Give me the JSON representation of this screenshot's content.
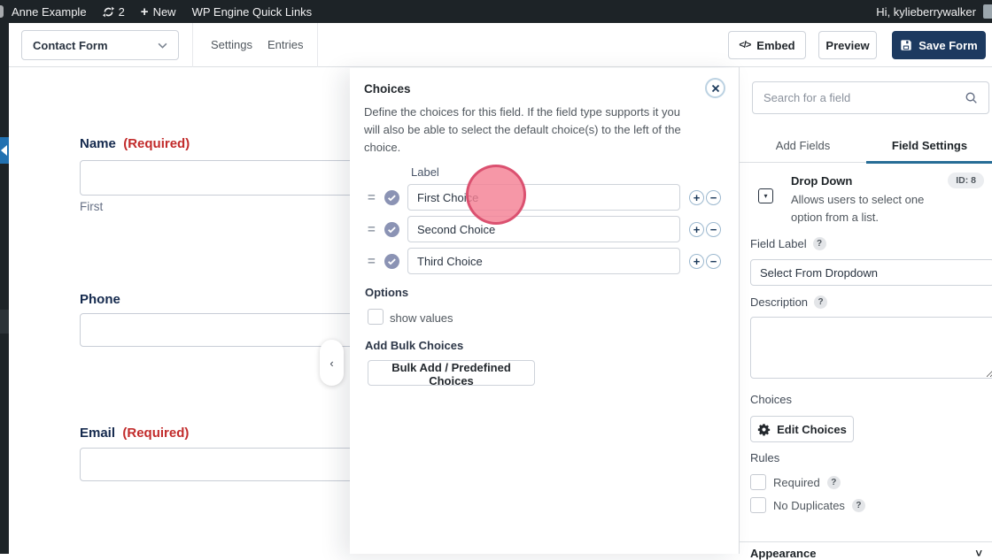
{
  "admin_bar": {
    "site_name": "Anne Example",
    "updates_count": "2",
    "new_label": "New",
    "quick_links": "WP Engine Quick Links",
    "greeting": "Hi, kylieberrywalker"
  },
  "toolbar": {
    "form_selector_value": "Contact Form",
    "settings": "Settings",
    "entries": "Entries",
    "embed_icon": "</>",
    "embed": "Embed",
    "preview": "Preview",
    "save": "Save Form"
  },
  "form_preview": {
    "fields": [
      {
        "label": "Name",
        "required": "(Required)",
        "sublabel": "First"
      },
      {
        "label": "Phone",
        "required": "",
        "sublabel": ""
      },
      {
        "label": "Email",
        "required": "(Required)",
        "sublabel": ""
      }
    ]
  },
  "flyout": {
    "title": "Choices",
    "description": "Define the choices for this field. If the field type supports it you will also be able to select the default choice(s) to the left of the choice.",
    "label_header": "Label",
    "rows": [
      {
        "label": "First Choice"
      },
      {
        "label": "Second Choice"
      },
      {
        "label": "Third Choice"
      }
    ],
    "plus": "+",
    "minus": "−",
    "options_header": "Options",
    "show_values": "show values",
    "bulk_header": "Add Bulk Choices",
    "bulk_button": "Bulk Add / Predefined Choices"
  },
  "sidebar": {
    "search_placeholder": "Search for a field",
    "tabs": [
      {
        "label": "Add Fields"
      },
      {
        "label": "Field Settings"
      }
    ],
    "field_type": {
      "name": "Drop Down",
      "id_badge": "ID: 8",
      "description": "Allows users to select one option from a list.",
      "icon_glyph": "▾"
    },
    "help_glyph": "?",
    "field_label": {
      "label": "Field Label",
      "value": "Select From Dropdown"
    },
    "description_label": "Description",
    "choices_label": "Choices",
    "edit_choices": "Edit Choices",
    "rules_label": "Rules",
    "required_label": "Required",
    "no_duplicates_label": "No Duplicates",
    "appearance_label": "Appearance",
    "chevron": "˅"
  },
  "misc": {
    "collapse_chevron": "‹",
    "selector_chevron": "˅",
    "drag_glyph": "="
  },
  "colors": {
    "admin_bar_bg": "#1d2327",
    "wp_blue": "#2271b1",
    "save_button_bg": "#1d3a60",
    "active_tab_underline": "#266d96",
    "required_red": "#c22b2b",
    "label_navy": "#152a4e",
    "click_ring_fill": "#f48094",
    "click_ring_border": "#d84a6a",
    "check_bubble": "#8b93b4"
  }
}
